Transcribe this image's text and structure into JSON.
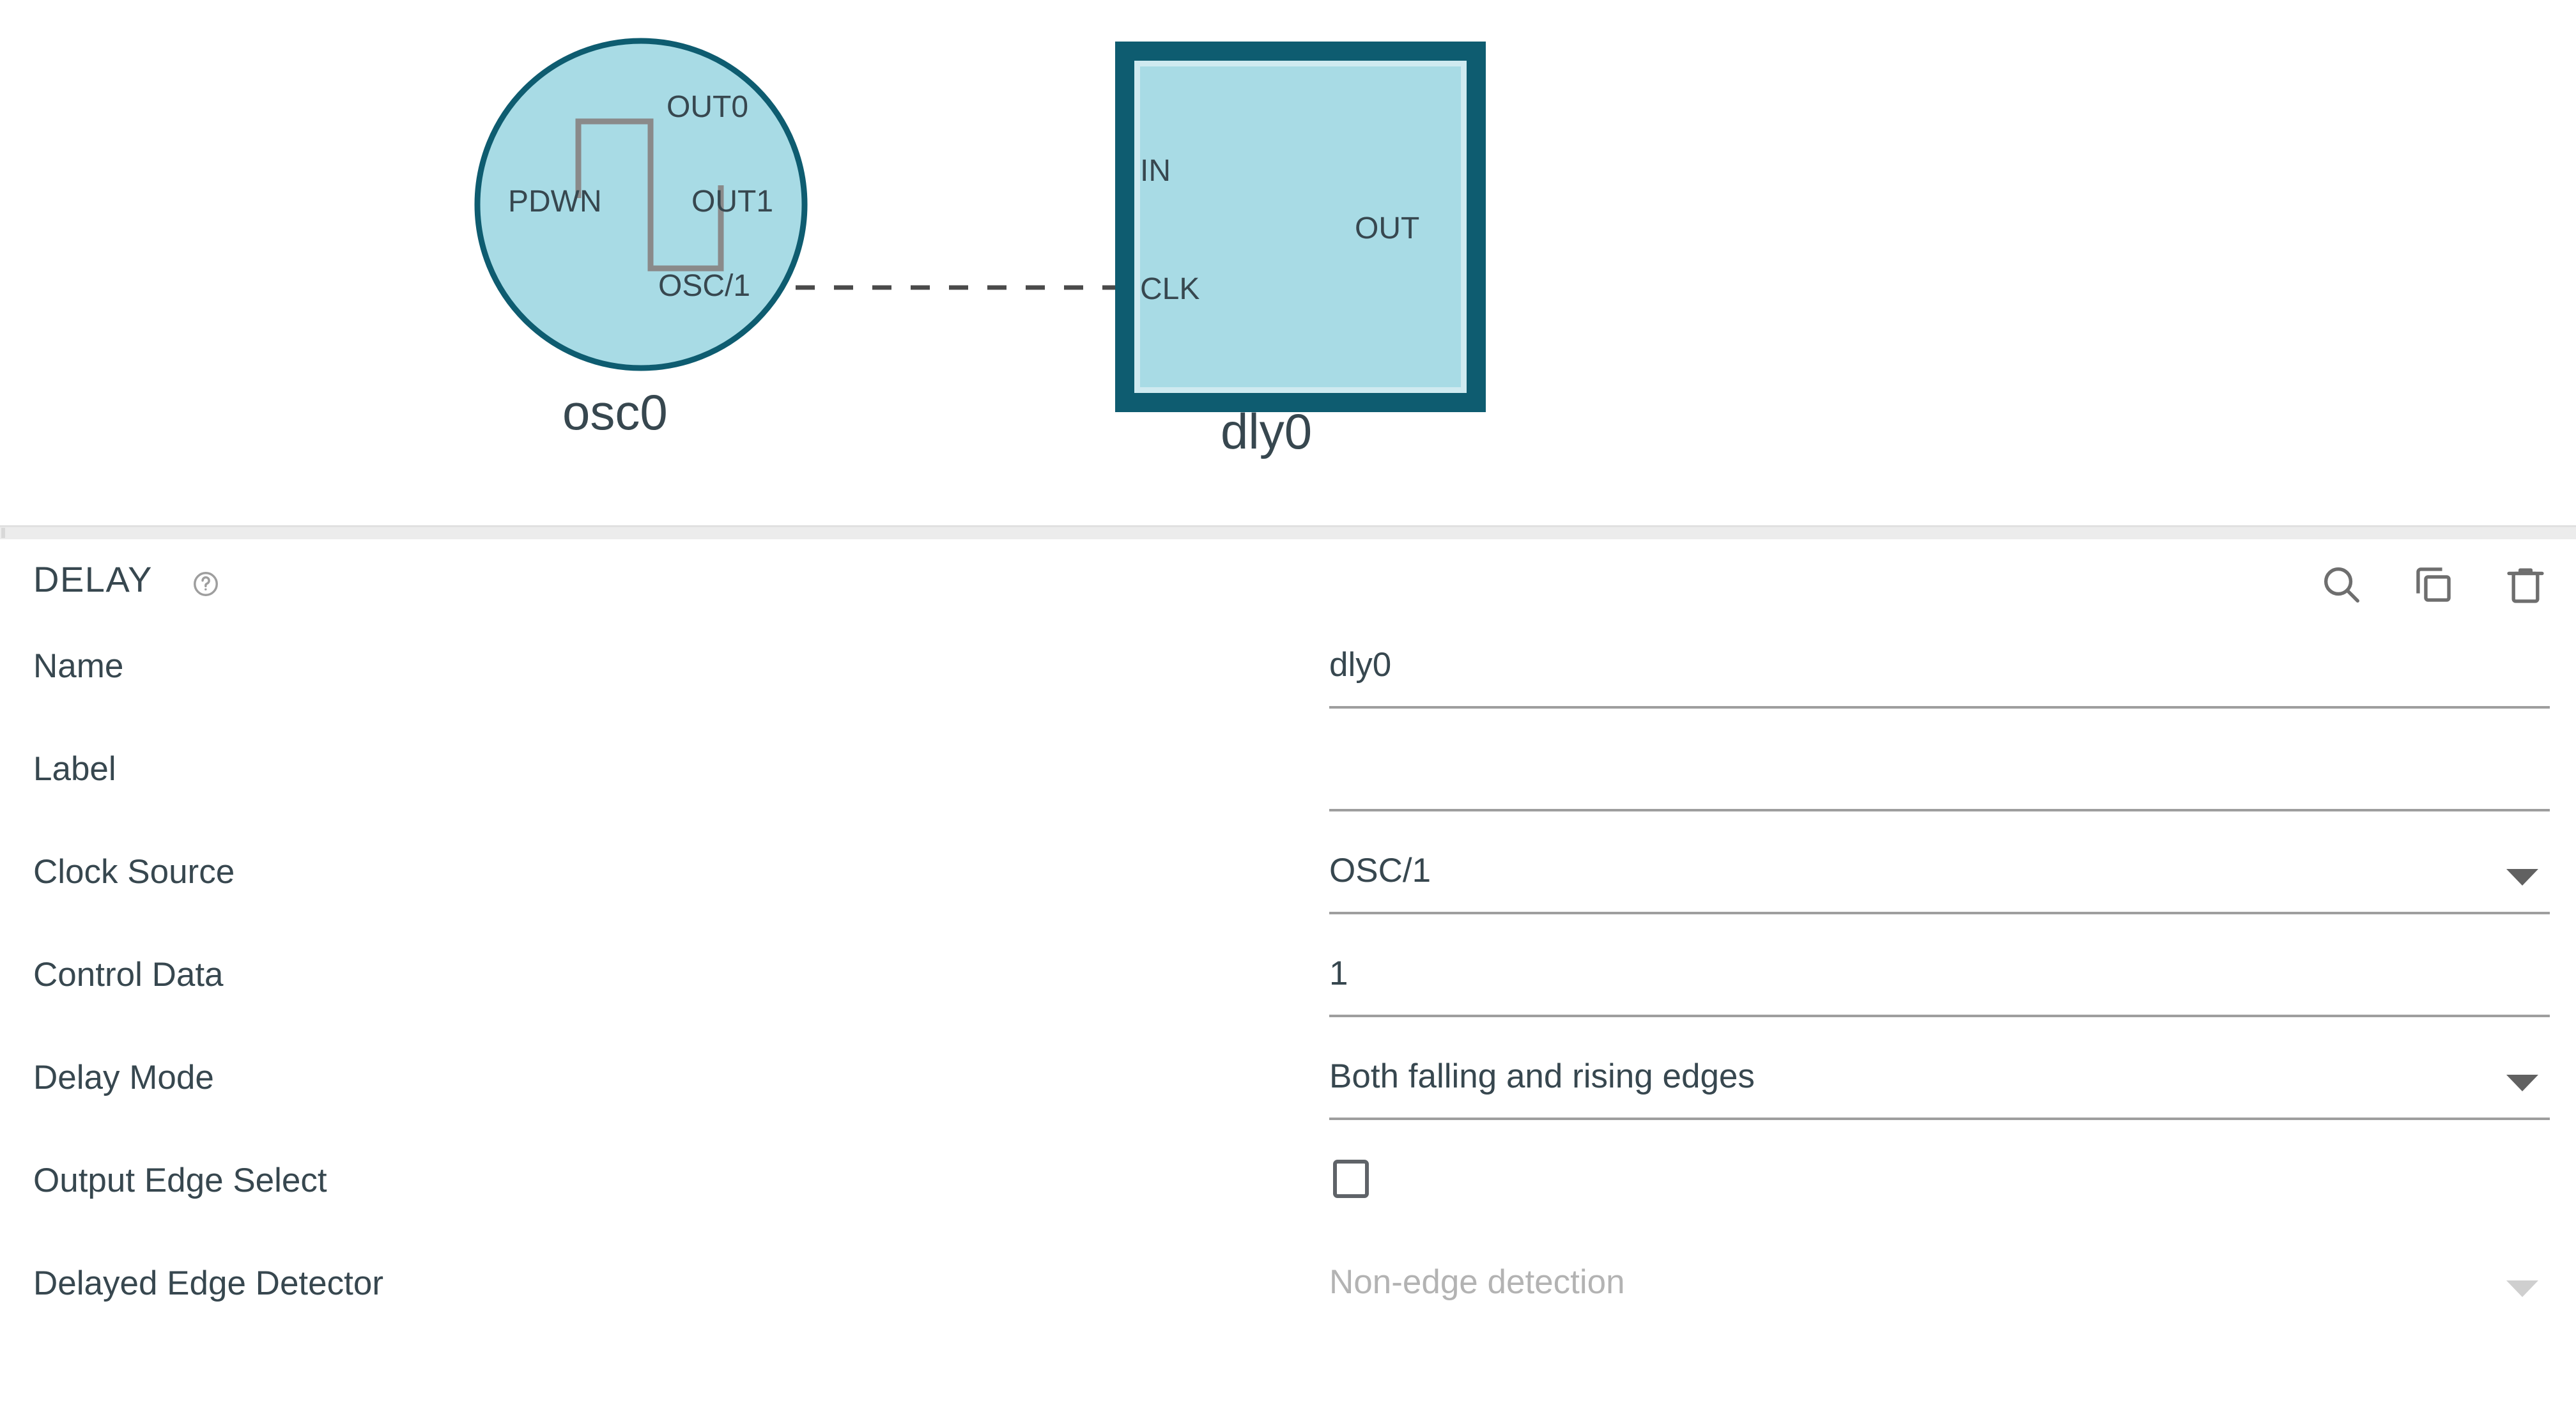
{
  "canvas": {
    "osc_node": {
      "name": "osc0",
      "type": "oscillator",
      "shape": "circle",
      "pins": [
        {
          "id": "pdwn",
          "label": "PDWN",
          "side": "left"
        },
        {
          "id": "out0",
          "label": "OUT0",
          "side": "right-top"
        },
        {
          "id": "out1",
          "label": "OUT1",
          "side": "right-middle"
        },
        {
          "id": "osc1",
          "label": "OSC/1",
          "side": "right-bottom"
        }
      ],
      "glyph": "square-wave"
    },
    "delay_node": {
      "name": "dly0",
      "type": "delay",
      "shape": "square",
      "pins": [
        {
          "id": "in",
          "label": "IN",
          "side": "left-top"
        },
        {
          "id": "clk",
          "label": "CLK",
          "side": "left-bottom"
        },
        {
          "id": "out",
          "label": "OUT",
          "side": "right"
        }
      ]
    },
    "wire": {
      "from": "osc0.OSC/1",
      "to": "dly0.CLK",
      "style": "dashed"
    },
    "colors": {
      "node_fill": "#a8dbe5",
      "node_stroke": "#0e5c70",
      "glyph_stroke": "#8a8a8a",
      "wire": "#4a4a4a",
      "node_label": "#37474f"
    }
  },
  "panel": {
    "title": "DELAY",
    "help_icon": "help-circle-icon",
    "tools": [
      {
        "id": "search",
        "icon": "search-icon"
      },
      {
        "id": "duplicate",
        "icon": "copy-icon"
      },
      {
        "id": "delete",
        "icon": "trash-icon"
      }
    ],
    "rows": [
      {
        "label": "Name",
        "control": "text",
        "value": "dly0",
        "disabled": false
      },
      {
        "label": "Label",
        "control": "text",
        "value": "",
        "disabled": false
      },
      {
        "label": "Clock Source",
        "control": "select",
        "value": "OSC/1",
        "disabled": false
      },
      {
        "label": "Control Data",
        "control": "text",
        "value": "1",
        "disabled": false
      },
      {
        "label": "Delay Mode",
        "control": "select",
        "value": "Both falling and rising edges",
        "disabled": false
      },
      {
        "label": "Output Edge Select",
        "control": "checkbox",
        "value": "",
        "checked": false,
        "disabled": false
      },
      {
        "label": "Delayed Edge Detector",
        "control": "select",
        "value": "Non-edge detection",
        "disabled": true
      }
    ],
    "colors": {
      "text": "#37474f",
      "disabled_text": "#b3b3b3",
      "underline": "#9e9e9e",
      "icon": "#6e6e6e",
      "divider": "#ececec"
    }
  }
}
